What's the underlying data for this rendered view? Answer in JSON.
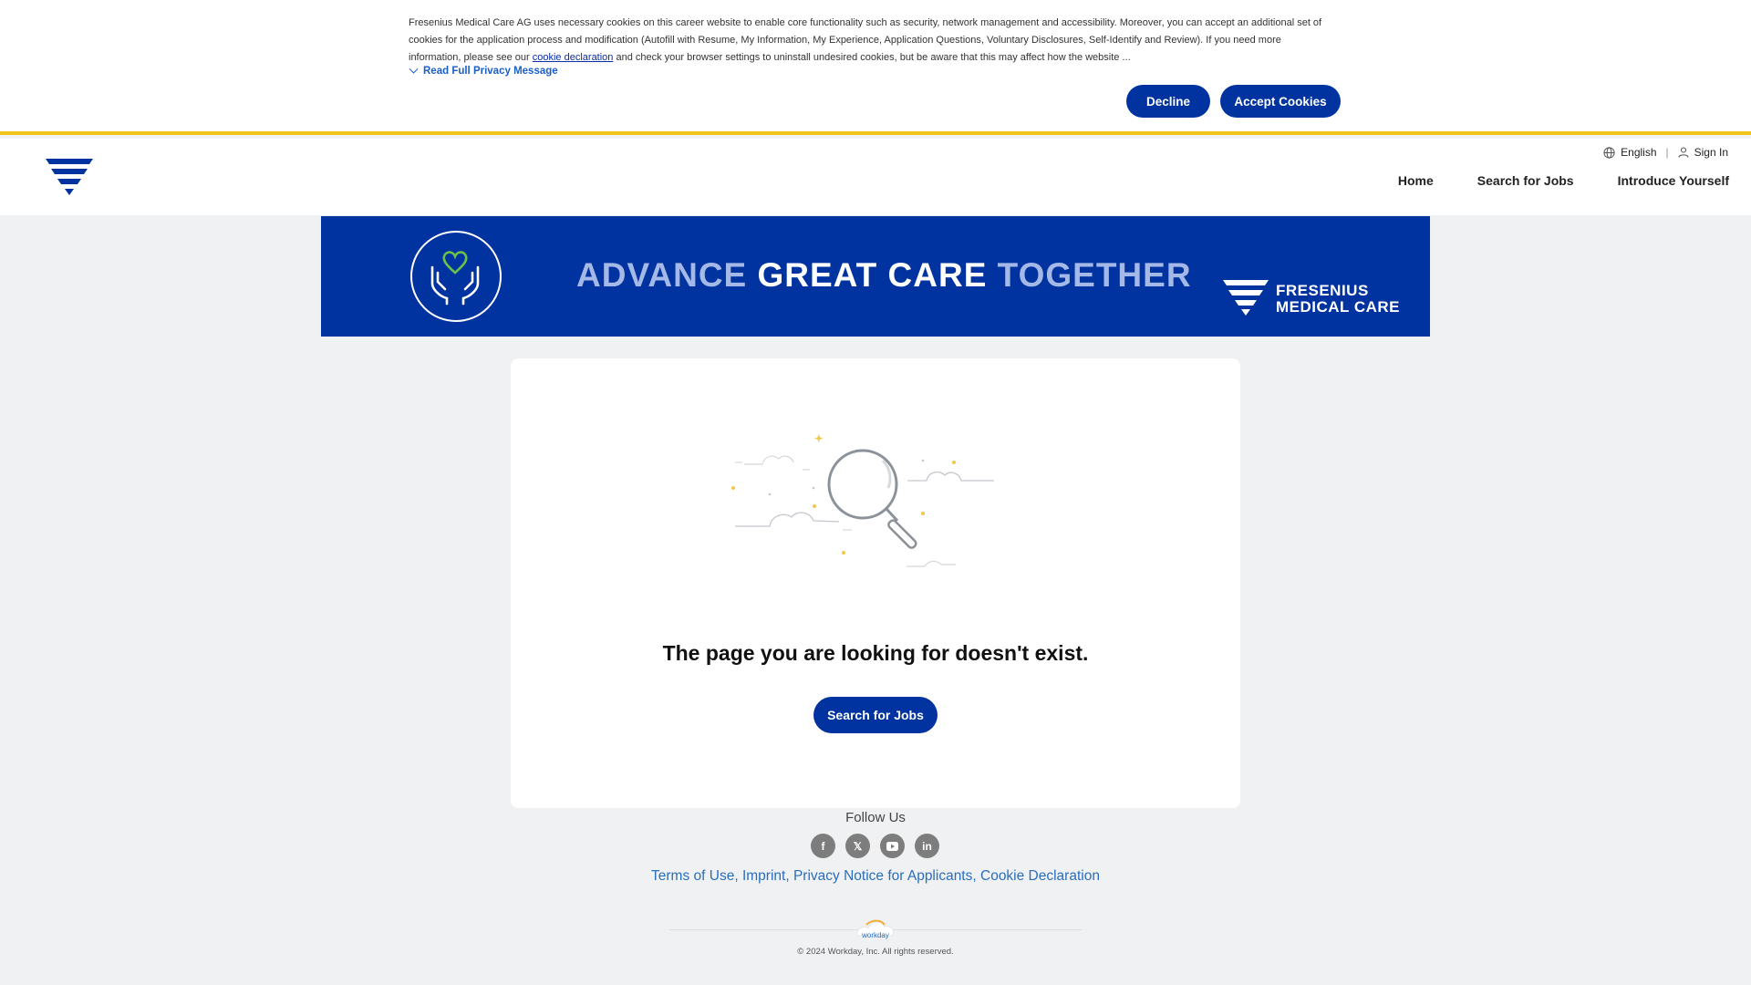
{
  "cookie_banner": {
    "text_before_link": "Fresenius Medical Care AG uses necessary cookies on this career website to enable core functionality such as security, network management and accessibility. Moreover, you can accept an additional set of cookies for the application process and modification (Autofill with Resume, My Information, My Experience, Application Questions, Voluntary Disclosures, Self-Identify and Review). If you need more information, please see our ",
    "link_text": "cookie declaration",
    "text_after_link": " and check your browser settings to uninstall undesired cookies, but be aware that this may affect how the website ...",
    "read_full_label": "Read Full Privacy Message",
    "decline_label": "Decline",
    "accept_label": "Accept Cookies"
  },
  "header": {
    "language": "English",
    "sign_in": "Sign In",
    "nav": [
      "Home",
      "Search for Jobs",
      "Introduce Yourself"
    ]
  },
  "hero": {
    "title_part1": "ADVANCE",
    "title_part2": "GREAT CARE",
    "title_part3": "TOGETHER",
    "brand_line1": "FRESENIUS",
    "brand_line2": "MEDICAL CARE"
  },
  "error_card": {
    "message": "The page you are looking for doesn't exist.",
    "button_label": "Search for Jobs"
  },
  "footer": {
    "follow_label": "Follow Us",
    "socials": [
      "facebook-icon",
      "x-icon",
      "youtube-icon",
      "linkedin-icon"
    ],
    "links": [
      "Terms of Use",
      "Imprint",
      "Privacy Notice for Applicants",
      "Cookie Declaration"
    ],
    "workday_logo_text": "workday",
    "copyright": "© 2024 Workday, Inc. All rights reserved."
  },
  "colors": {
    "brand_blue": "#0033a0",
    "accent_yellow": "#f0c419",
    "link_blue": "#2a6ebb"
  }
}
